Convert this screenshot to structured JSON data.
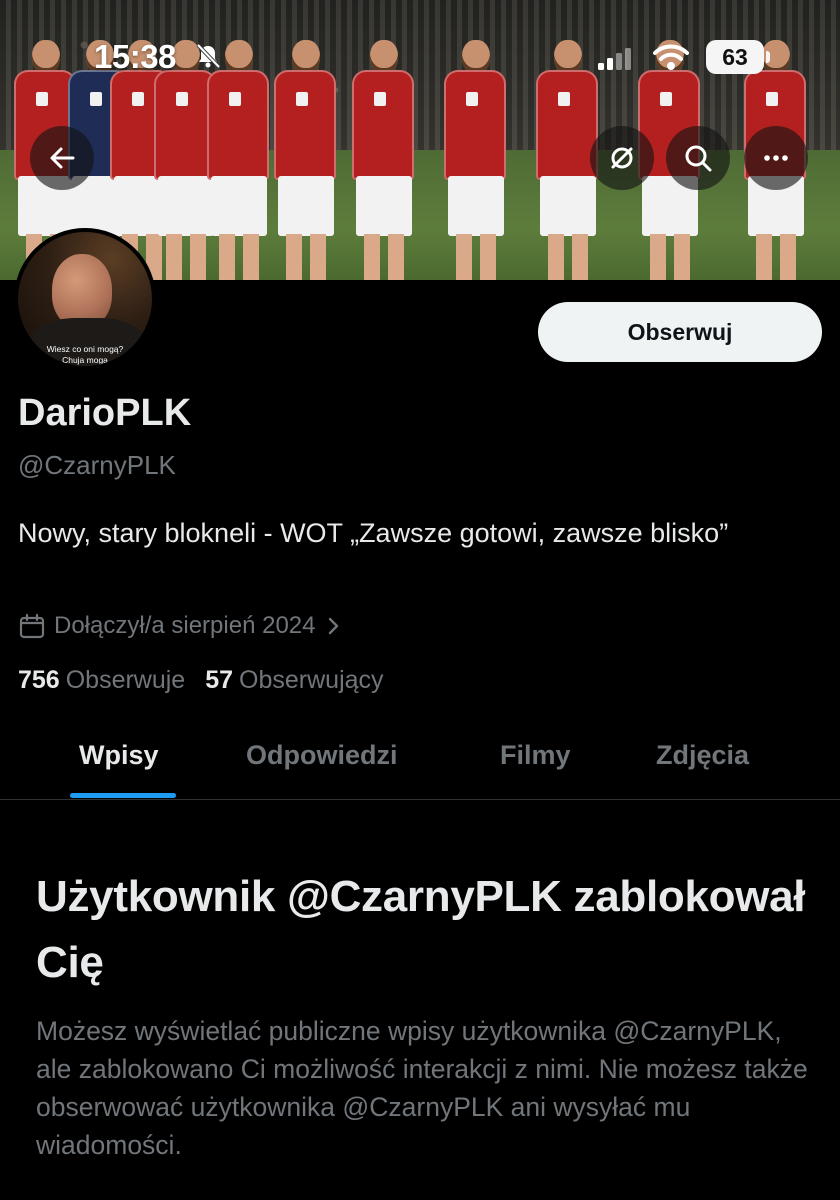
{
  "status_bar": {
    "time": "15:38",
    "battery": "63",
    "icons": [
      "bell-slash-icon",
      "signal-icon",
      "wifi-icon",
      "battery-icon"
    ]
  },
  "header": {
    "icons": [
      "back-arrow-icon",
      "privacy-icon",
      "search-icon",
      "more-icon"
    ]
  },
  "avatar": {
    "caption_line1": "Wiesz co oni mogą?",
    "caption_line2": "Chuja mogą"
  },
  "profile": {
    "follow_label": "Obserwuj",
    "display_name": "DarioPLK",
    "handle": "@CzarnyPLK",
    "bio": "Nowy, stary blokneli - WOT „Zawsze gotowi, zawsze blisko”",
    "joined": "Dołączył/a sierpień 2024",
    "following_count": "756",
    "following_label": "Obserwuje",
    "followers_count": "57",
    "followers_label": "Obserwujący"
  },
  "tabs": [
    {
      "label": "Wpisy",
      "active": true
    },
    {
      "label": "Odpowiedzi",
      "active": false
    },
    {
      "label": "Filmy",
      "active": false
    },
    {
      "label": "Zdjęcia",
      "active": false
    }
  ],
  "blocked": {
    "title": "Użytkownik @CzarnyPLK zablokował Cię",
    "text": "Możesz wyświetlać publiczne wpisy użytkownika @CzarnyPLK, ale zablokowano Ci możliwość interakcji z nimi. Nie możesz także obserwować użytkownika @CzarnyPLK ani wysyłać mu wiadomości."
  },
  "colors": {
    "accent": "#1d9bf0",
    "background": "#000000",
    "text_primary": "#e7e9ea",
    "text_secondary": "#71767b"
  }
}
